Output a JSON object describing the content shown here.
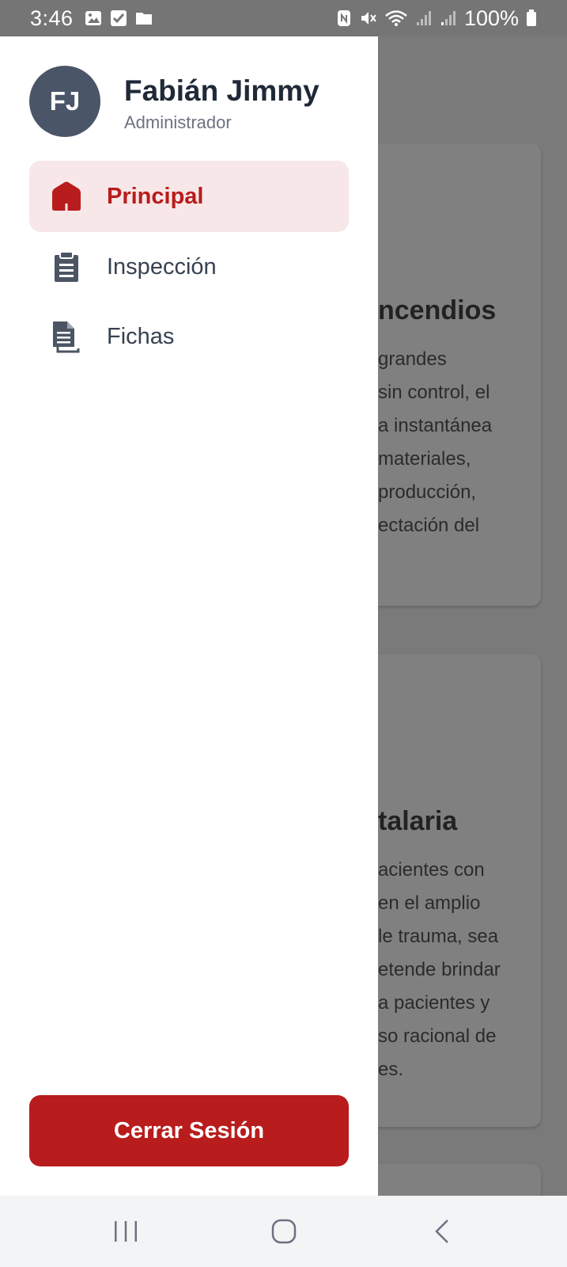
{
  "status_bar": {
    "time": "3:46",
    "battery": "100%",
    "left_icons": [
      "image-icon",
      "checkbox-icon",
      "folder-icon"
    ],
    "right_icons": [
      "nfc-icon",
      "mute-icon",
      "wifi-icon",
      "signal-icon",
      "signal-icon",
      "battery-icon"
    ]
  },
  "drawer": {
    "user": {
      "initials": "FJ",
      "name": "Fabián Jimmy",
      "role": "Administrador"
    },
    "items": [
      {
        "label": "Principal",
        "icon": "home-icon",
        "active": true
      },
      {
        "label": "Inspección",
        "icon": "clipboard-icon",
        "active": false
      },
      {
        "label": "Fichas",
        "icon": "documents-icon",
        "active": false
      }
    ],
    "logout_label": "Cerrar Sesión"
  },
  "background_content": {
    "cards": [
      {
        "title": "ncendios",
        "lines": [
          "grandes",
          "sin control, el",
          "a instantánea",
          "materiales,",
          "producción,",
          "ectación del"
        ]
      },
      {
        "title": "talaria",
        "lines": [
          "acientes con",
          "en el amplio",
          "le trauma, sea",
          "etende brindar",
          "a pacientes y",
          "so racional de",
          "es."
        ]
      }
    ]
  },
  "nav_bar": {
    "buttons": [
      "recent-apps-icon",
      "home-circle-icon",
      "back-icon"
    ]
  },
  "colors": {
    "accent": "#b91c1c",
    "active_bg": "#f8e7e8",
    "avatar_bg": "#4a5568",
    "status_bar": "#757575",
    "scrim": "#7a7a7a"
  }
}
